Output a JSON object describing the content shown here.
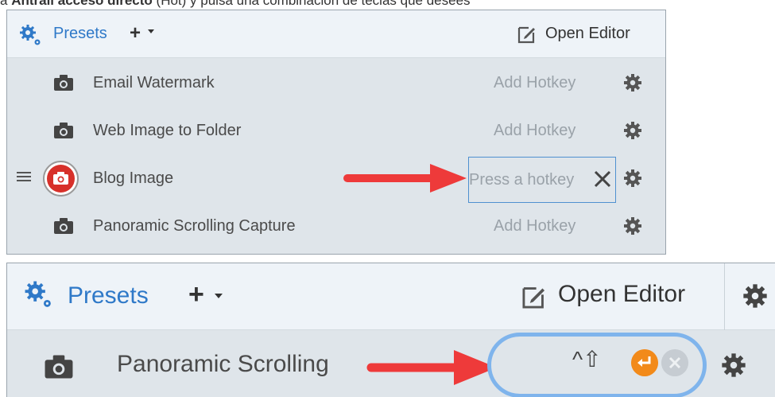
{
  "clipped_text": {
    "before": "a ",
    "bold": "Antrall acceso directo",
    "after": " (Hot) y pulsa una combinación de teclas que desees"
  },
  "panel_top": {
    "header": {
      "gear_icon": "gear-cluster-icon",
      "title": "Presets",
      "add_symbol": "+",
      "open_editor_label": "Open Editor",
      "open_editor_icon": "edit-icon"
    },
    "rows": [
      {
        "label": "Email Watermark",
        "hotkey": "Add Hotkey",
        "icon": "camera-icon"
      },
      {
        "label": "Web Image to Folder",
        "hotkey": "Add Hotkey",
        "icon": "camera-icon"
      },
      {
        "label": "Blog Image",
        "hotkey_placeholder": "Press a hotkey",
        "clear_symbol": "✕",
        "icon": "camera-icon",
        "selected": true
      },
      {
        "label": "Panoramic Scrolling Capture",
        "hotkey": "Add Hotkey",
        "icon": "camera-icon"
      }
    ]
  },
  "panel_bottom": {
    "header": {
      "title": "Presets",
      "add_symbol": "+",
      "open_editor_label": "Open Editor"
    },
    "row": {
      "label": "Panoramic Scrolling",
      "keys": "^⇧",
      "enter_icon": "enter-icon",
      "clear_icon": "clear-icon"
    }
  },
  "colors": {
    "accent_blue": "#2f79c8",
    "panel_bg": "#dfe5ea",
    "header_bg": "#eef3f8",
    "arrow_red": "#ee3a3a",
    "enter_orange": "#f28a1a",
    "focus_ring": "#7fb4ec"
  }
}
